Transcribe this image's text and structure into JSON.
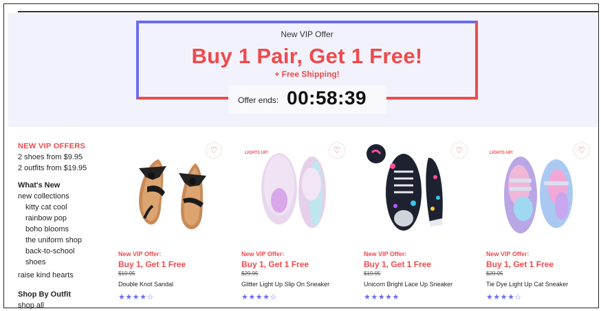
{
  "banner": {
    "vip_label": "New VIP Offer",
    "headline": "Buy 1 Pair, Get 1 Free!",
    "shipping": "+ Free Shipping!",
    "timer_label": "Offer ends:",
    "timer_value": "00:58:39"
  },
  "sidebar": {
    "offers_title": "NEW VIP OFFERS",
    "offers": [
      "2 shoes from $9.95",
      "2 outfits from $19.95"
    ],
    "whats_new_title": "What's New",
    "new_collections": "new collections",
    "collections": [
      "kitty cat cool",
      "rainbow pop",
      "boho blooms",
      "the uniform shop",
      "back-to-school",
      "shoes"
    ],
    "raise_kind_hearts": "raise kind hearts",
    "shop_by_outfit_title": "Shop By Outfit",
    "shop_all": "shop all"
  },
  "products": [
    {
      "offer_label": "New VIP Offer:",
      "deal": "Buy 1, Get 1 Free",
      "old_price": "$19.95",
      "name": "Double Knot Sandal",
      "stars": "★★★★☆",
      "badge": ""
    },
    {
      "offer_label": "New VIP Offer:",
      "deal": "Buy 1, Get 1 Free",
      "old_price": "$29.95",
      "name": "Glitter Light Up Slip On Sneaker",
      "stars": "★★★★☆",
      "badge": "LIGHTS UP!"
    },
    {
      "offer_label": "New VIP Offer:",
      "deal": "Buy 1, Get 1 Free",
      "old_price": "$19.95",
      "name": "Unicorn Bright Lace Up Sneaker",
      "stars": "★★★★★",
      "badge": ""
    },
    {
      "offer_label": "New VIP Offer:",
      "deal": "Buy 1, Get 1 Free",
      "old_price": "$29.95",
      "name": "Tie Dye Light Up Cat Sneaker",
      "stars": "★★★★☆",
      "badge": "LIGHTS UP!"
    }
  ],
  "colors": {
    "accent_red": "#f0494c",
    "accent_blue": "#6a6cf2",
    "banner_bg": "#f1f2fb"
  },
  "icons": {
    "wishlist": "heart-icon"
  }
}
